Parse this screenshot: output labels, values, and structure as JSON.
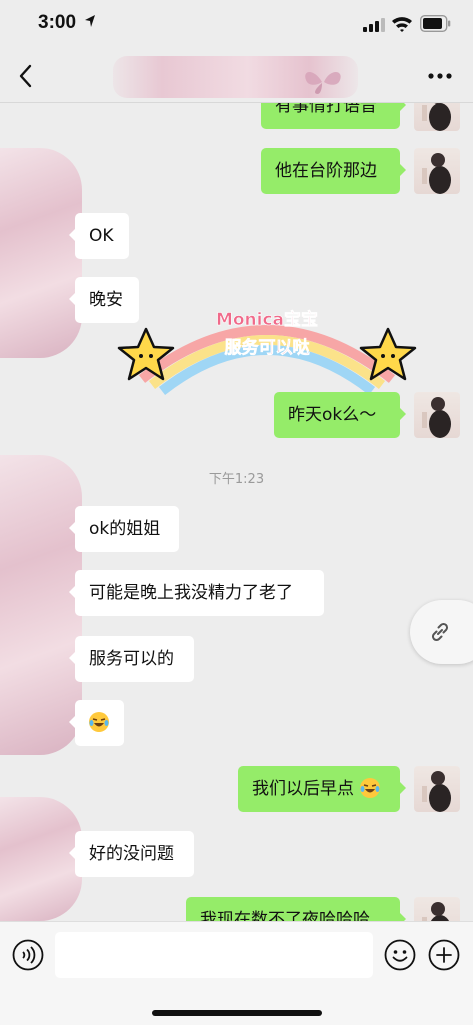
{
  "status_bar": {
    "time": "3:00"
  },
  "header": {
    "back_icon": "chevron-left-icon",
    "more_icon": "ellipsis-icon"
  },
  "messages": [
    {
      "side": "right",
      "text": "有事情打语音"
    },
    {
      "side": "right",
      "text": "他在台阶那边"
    },
    {
      "side": "left",
      "text": "OK"
    },
    {
      "side": "left",
      "text": "晚安"
    },
    {
      "side": "right",
      "text": "昨天ok么～"
    },
    {
      "side": "left",
      "text": "ok的姐姐"
    },
    {
      "side": "left",
      "text": "可能是晚上我没精力了老了"
    },
    {
      "side": "left",
      "text": "服务可以的"
    },
    {
      "side": "right",
      "text": "我们以后早点"
    },
    {
      "side": "left",
      "text": "好的没问题"
    },
    {
      "side": "right",
      "text": "我现在数不了夜哈哈哈"
    }
  ],
  "sticker": {
    "line1": "Monica宝宝",
    "line2": "服务可以哒"
  },
  "timestamp": "下午1:23",
  "colors": {
    "outgoing_bubble": "#95ec69",
    "incoming_bubble": "#ffffff",
    "background": "#ededed"
  },
  "input_bar": {
    "icons": [
      "voice-icon",
      "emoji-icon",
      "plus-icon"
    ]
  }
}
